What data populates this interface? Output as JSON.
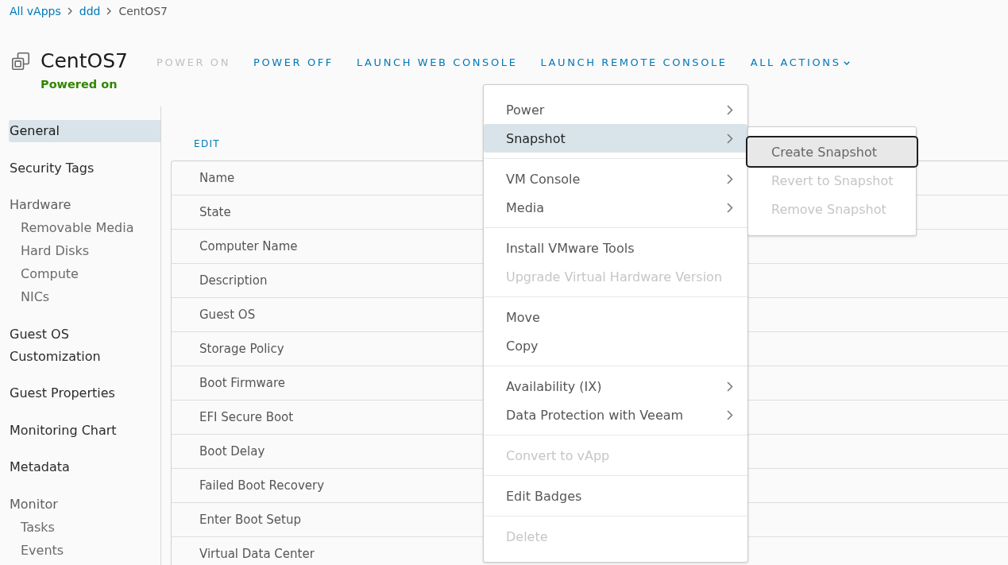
{
  "breadcrumb": [
    {
      "label": "All vApps",
      "current": false
    },
    {
      "label": "ddd",
      "current": false
    },
    {
      "label": "CentOS7",
      "current": true
    }
  ],
  "vm": {
    "name": "CentOS7",
    "status": {
      "label": "Powered on",
      "on": true
    }
  },
  "actions": [
    {
      "label": "POWER ON",
      "kind": "button",
      "disabled": true
    },
    {
      "label": "POWER OFF",
      "kind": "button",
      "disabled": false
    },
    {
      "label": "LAUNCH WEB CONSOLE",
      "kind": "button",
      "disabled": false
    },
    {
      "label": "LAUNCH REMOTE CONSOLE",
      "kind": "button",
      "disabled": false
    },
    {
      "label": "ALL ACTIONS",
      "kind": "dropdown",
      "disabled": false
    }
  ],
  "sidebar": {
    "items": [
      {
        "label": "General",
        "kind": "link",
        "selected": true
      },
      {
        "label": "Security Tags",
        "kind": "link",
        "selected": false
      },
      {
        "label": "Hardware",
        "kind": "group",
        "selected": false,
        "children": [
          {
            "label": "Removable Media",
            "selected": false
          },
          {
            "label": "Hard Disks",
            "selected": false
          },
          {
            "label": "Compute",
            "selected": false
          },
          {
            "label": "NICs",
            "selected": false
          }
        ]
      },
      {
        "label": "Guest OS Customization",
        "kind": "link",
        "selected": false
      },
      {
        "label": "Guest Properties",
        "kind": "link",
        "selected": false
      },
      {
        "label": "Monitoring Chart",
        "kind": "link",
        "selected": false
      },
      {
        "label": "Metadata",
        "kind": "link",
        "selected": false
      },
      {
        "label": "Monitor",
        "kind": "group",
        "selected": false,
        "children": [
          {
            "label": "Tasks",
            "selected": false
          },
          {
            "label": "Events",
            "selected": false
          }
        ]
      }
    ]
  },
  "details": {
    "edit_label": "EDIT",
    "rows": [
      {
        "label": "Name"
      },
      {
        "label": "State"
      },
      {
        "label": "Computer Name"
      },
      {
        "label": "Description"
      },
      {
        "label": "Guest OS"
      },
      {
        "label": "Storage Policy"
      },
      {
        "label": "Boot Firmware"
      },
      {
        "label": "EFI Secure Boot"
      },
      {
        "label": "Boot Delay"
      },
      {
        "label": "Failed Boot Recovery"
      },
      {
        "label": "Enter Boot Setup"
      },
      {
        "label": "Virtual Data Center"
      }
    ]
  },
  "actions_menu": {
    "groups": [
      {
        "items": [
          {
            "label": "Power",
            "has_submenu": true,
            "selected": false,
            "disabled": false
          },
          {
            "label": "Snapshot",
            "has_submenu": true,
            "selected": true,
            "disabled": false
          }
        ]
      },
      {
        "items": [
          {
            "label": "VM Console",
            "has_submenu": true,
            "selected": false,
            "disabled": false
          },
          {
            "label": "Media",
            "has_submenu": true,
            "selected": false,
            "disabled": false
          }
        ]
      },
      {
        "items": [
          {
            "label": "Install VMware Tools",
            "has_submenu": false,
            "selected": false,
            "disabled": false
          },
          {
            "label": "Upgrade Virtual Hardware Version",
            "has_submenu": false,
            "selected": false,
            "disabled": true
          }
        ]
      },
      {
        "items": [
          {
            "label": "Move",
            "has_submenu": false,
            "selected": false,
            "disabled": false
          },
          {
            "label": "Copy",
            "has_submenu": false,
            "selected": false,
            "disabled": false
          }
        ]
      },
      {
        "items": [
          {
            "label": "Availability (IX)",
            "has_submenu": true,
            "selected": false,
            "disabled": false
          },
          {
            "label": "Data Protection with Veeam",
            "has_submenu": true,
            "selected": false,
            "disabled": false
          }
        ]
      },
      {
        "items": [
          {
            "label": "Convert to vApp",
            "has_submenu": false,
            "selected": false,
            "disabled": true
          }
        ]
      },
      {
        "items": [
          {
            "label": "Edit Badges",
            "has_submenu": false,
            "selected": false,
            "disabled": false
          }
        ]
      },
      {
        "items": [
          {
            "label": "Delete",
            "has_submenu": false,
            "selected": false,
            "disabled": true
          }
        ]
      }
    ]
  },
  "submenu": {
    "items": [
      {
        "label": "Create Snapshot",
        "focused": true,
        "disabled": false
      },
      {
        "label": "Revert to Snapshot",
        "focused": false,
        "disabled": true
      },
      {
        "label": "Remove Snapshot",
        "focused": false,
        "disabled": true
      }
    ]
  }
}
